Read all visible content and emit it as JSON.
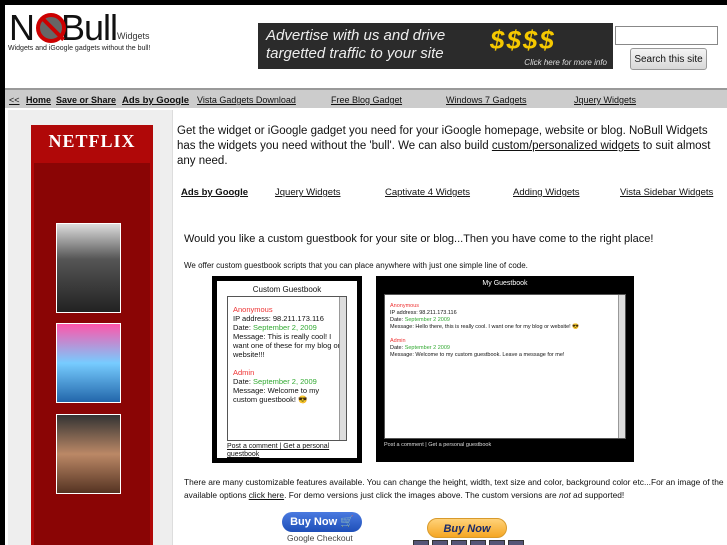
{
  "header": {
    "logo_text": "NoBull",
    "logo_sub": "Widgets",
    "tagline": "Widgets and iGoogle gadgets without the bull!",
    "banner": {
      "line1": "Advertise with us and drive",
      "line2": "targetted traffic to your site",
      "dollars": "$$$$",
      "cta": "Click here for more info"
    },
    "search": {
      "value": "",
      "button": "Search this site"
    }
  },
  "nav": {
    "back": "<<",
    "home": "Home",
    "save": "Save or Share",
    "ads": "Ads by Google",
    "links": [
      "Vista Gadgets Download",
      "Free Blog Gadget",
      "Windows 7 Gadgets",
      "Jquery Widgets"
    ]
  },
  "sidebar_ad": {
    "logo": "NETFLIX"
  },
  "main": {
    "intro_a": "Get the widget or iGoogle gadget you need for your iGoogle homepage, website or blog. NoBull Widgets has the widgets you need without the 'bull'. We can also build ",
    "intro_link": "custom/personalized widgets",
    "intro_b": " to suit almost any need.",
    "ads": {
      "label": "Ads by Google",
      "links": [
        "Jquery Widgets",
        "Captivate 4 Widgets",
        "Adding Widgets",
        "Vista Sidebar Widgets"
      ]
    },
    "question": "Would you like a custom guestbook for your site or blog...Then you have come to the right place!",
    "offer": "We offer custom guestbook scripts that you can place anywhere with just one simple line of code.",
    "gb1": {
      "title": "Custom Guestbook",
      "e1_name": "Anonymous",
      "e1_ip": "IP address: 98.211.173.116",
      "e1_date_label": "Date: ",
      "e1_date": "September 2, 2009",
      "e1_msg": "Message: This is really cool! I want one of these for my blog or website!!!",
      "e2_name": "Admin",
      "e2_date_label": "Date: ",
      "e2_date": "September 2, 2009",
      "e2_msg": "Message: Welcome to my custom guestbook! 😎",
      "links": "Post a comment | Get a personal guestbook"
    },
    "gb2": {
      "title": "My Guestbook",
      "e1_name": "Anonymous",
      "e1_ip": "IP address: 98.211.173.116",
      "e1_date_label": "Date: ",
      "e1_date": "September 2 2009",
      "e1_msg": "Message: Hello there, this is really cool. I want one for my blog or website! 😎",
      "e2_name": "Admin",
      "e2_date_label": "Date: ",
      "e2_date": "September 2 2009",
      "e2_msg": "Message: Welcome to my custom guestbook. Leave a message for me!",
      "links": "Post a comment | Get a personal guestbook"
    },
    "footer_a": "There are many customizable features available. You can change the height, width, text size and color, background color etc...For an image of the available options ",
    "footer_link": "click here",
    "footer_b": ". For demo versions just click the images above. The custom versions are ",
    "footer_em": "not",
    "footer_c": " ad supported!",
    "buy1": "Buy Now 🛒",
    "buy1_sub": "Google Checkout",
    "buy2": "Buy Now"
  }
}
